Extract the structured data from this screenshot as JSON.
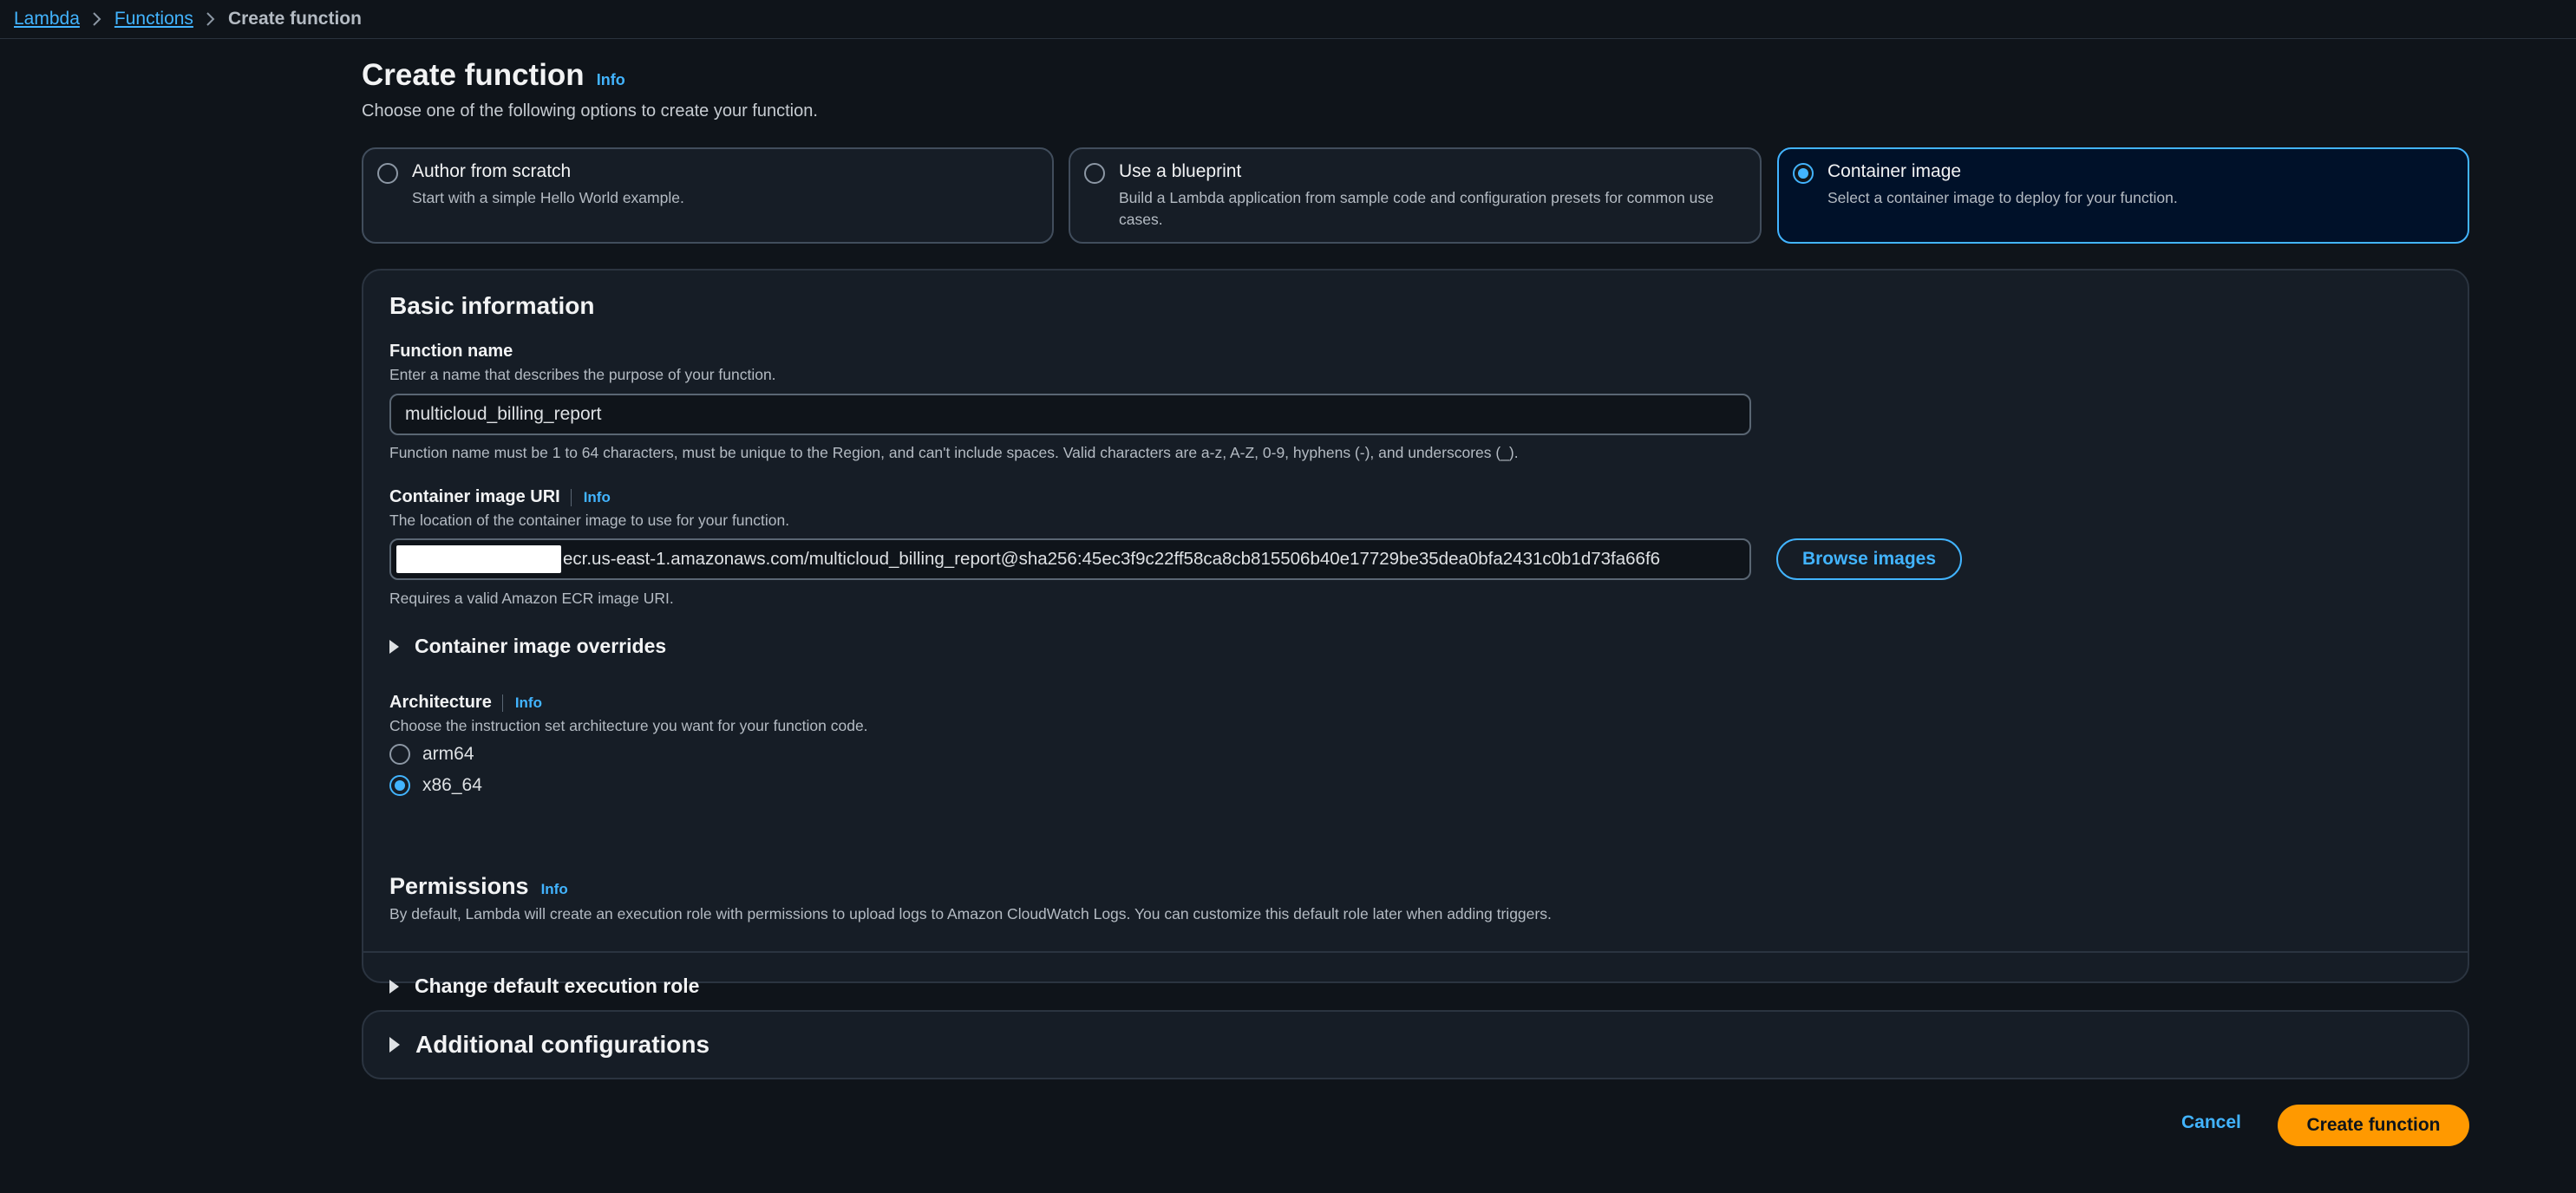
{
  "breadcrumb": {
    "items": [
      "Lambda",
      "Functions"
    ],
    "current": "Create function"
  },
  "page": {
    "title": "Create function",
    "info": "Info",
    "subtitle": "Choose one of the following options to create your function."
  },
  "options": [
    {
      "title": "Author from scratch",
      "desc": "Start with a simple Hello World example.",
      "selected": false
    },
    {
      "title": "Use a blueprint",
      "desc": "Build a Lambda application from sample code and configuration presets for common use cases.",
      "selected": false
    },
    {
      "title": "Container image",
      "desc": "Select a container image to deploy for your function.",
      "selected": true
    }
  ],
  "basic": {
    "title": "Basic information",
    "function_name": {
      "label": "Function name",
      "desc": "Enter a name that describes the purpose of your function.",
      "value": "multicloud_billing_report",
      "constraint": "Function name must be 1 to 64 characters, must be unique to the Region, and can't include spaces. Valid characters are a-z, A-Z, 0-9, hyphens (-), and underscores (_)."
    },
    "image_uri": {
      "label": "Container image URI",
      "info": "Info",
      "desc": "The location of the container image to use for your function.",
      "value": "ecr.us-east-1.amazonaws.com/multicloud_billing_report@sha256:45ec3f9c22ff58ca8cb815506b40e17729be35dea0bfa2431c0b1d73fa66f6",
      "browse": "Browse images",
      "hint": "Requires a valid Amazon ECR image URI."
    },
    "overrides": "Container image overrides",
    "architecture": {
      "label": "Architecture",
      "info": "Info",
      "desc": "Choose the instruction set architecture you want for your function code.",
      "options": [
        "arm64",
        "x86_64"
      ],
      "selected": "x86_64"
    },
    "permissions": {
      "title": "Permissions",
      "info": "Info",
      "desc": "By default, Lambda will create an execution role with permissions to upload logs to Amazon CloudWatch Logs. You can customize this default role later when adding triggers."
    },
    "exec_role": "Change default execution role"
  },
  "additional": "Additional configurations",
  "actions": {
    "cancel": "Cancel",
    "create": "Create function"
  }
}
